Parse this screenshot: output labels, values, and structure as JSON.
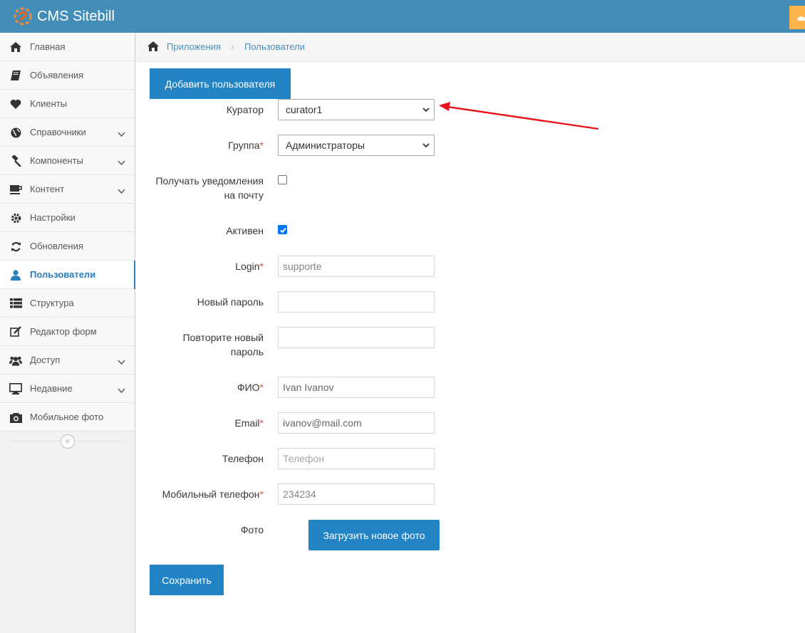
{
  "header": {
    "brand": "CMS Sitebill"
  },
  "sidebar": {
    "items": [
      {
        "label": "Главная",
        "icon": "home-icon",
        "arrow": false,
        "active": false
      },
      {
        "label": "Объявления",
        "icon": "book-icon",
        "arrow": false,
        "active": false
      },
      {
        "label": "Клиенты",
        "icon": "heart-icon",
        "arrow": false,
        "active": false
      },
      {
        "label": "Справочники",
        "icon": "globe-icon",
        "arrow": true,
        "active": false
      },
      {
        "label": "Компоненты",
        "icon": "gavel-icon",
        "arrow": true,
        "active": false
      },
      {
        "label": "Контент",
        "icon": "coffee-icon",
        "arrow": true,
        "active": false
      },
      {
        "label": "Настройки",
        "icon": "cog-icon",
        "arrow": false,
        "active": false
      },
      {
        "label": "Обновления",
        "icon": "refresh-icon",
        "arrow": false,
        "active": false
      },
      {
        "label": "Пользователи",
        "icon": "user-icon",
        "arrow": false,
        "active": true
      },
      {
        "label": "Структура",
        "icon": "list-icon",
        "arrow": false,
        "active": false
      },
      {
        "label": "Редактор форм",
        "icon": "edit-icon",
        "arrow": false,
        "active": false
      },
      {
        "label": "Доступ",
        "icon": "users-icon",
        "arrow": true,
        "active": false
      },
      {
        "label": "Недавние",
        "icon": "desktop-icon",
        "arrow": true,
        "active": false
      },
      {
        "label": "Мобильное фото",
        "icon": "camera-icon",
        "arrow": false,
        "active": false
      }
    ]
  },
  "breadcrumbs": [
    "Приложения",
    "Пользователи"
  ],
  "form": {
    "add_button": "Добавить пользователя",
    "curator": {
      "label": "Куратор",
      "value": "curator1"
    },
    "group": {
      "label": "Группа",
      "value": "Администраторы"
    },
    "notify": {
      "label_1": "Получать уведомления",
      "label_2": "на почту",
      "checked": false
    },
    "active": {
      "label": "Активен",
      "checked": true
    },
    "login": {
      "label": "Login",
      "value": "supporte"
    },
    "new_password": {
      "label": "Новый пароль",
      "value": ""
    },
    "repeat_password": {
      "label_1": "Повторите новый",
      "label_2": "пароль",
      "value": ""
    },
    "fio": {
      "label": "ФИО",
      "value": "Ivan Ivanov"
    },
    "email": {
      "label": "Email",
      "value": "ivanov@mail.com"
    },
    "phone": {
      "label": "Телефон",
      "placeholder": "Телефон"
    },
    "mobile": {
      "label": "Мобильный телефон",
      "value": "234234"
    },
    "photo": {
      "label": "Фото",
      "button": "Загрузить новое фото"
    },
    "required_mark": "*",
    "save_button": "Сохранить"
  },
  "colors": {
    "navbar": "#438eb9",
    "primary_button": "#2283c5",
    "accent": "#ffb44b",
    "annotation_arrow": "#e8141b"
  }
}
